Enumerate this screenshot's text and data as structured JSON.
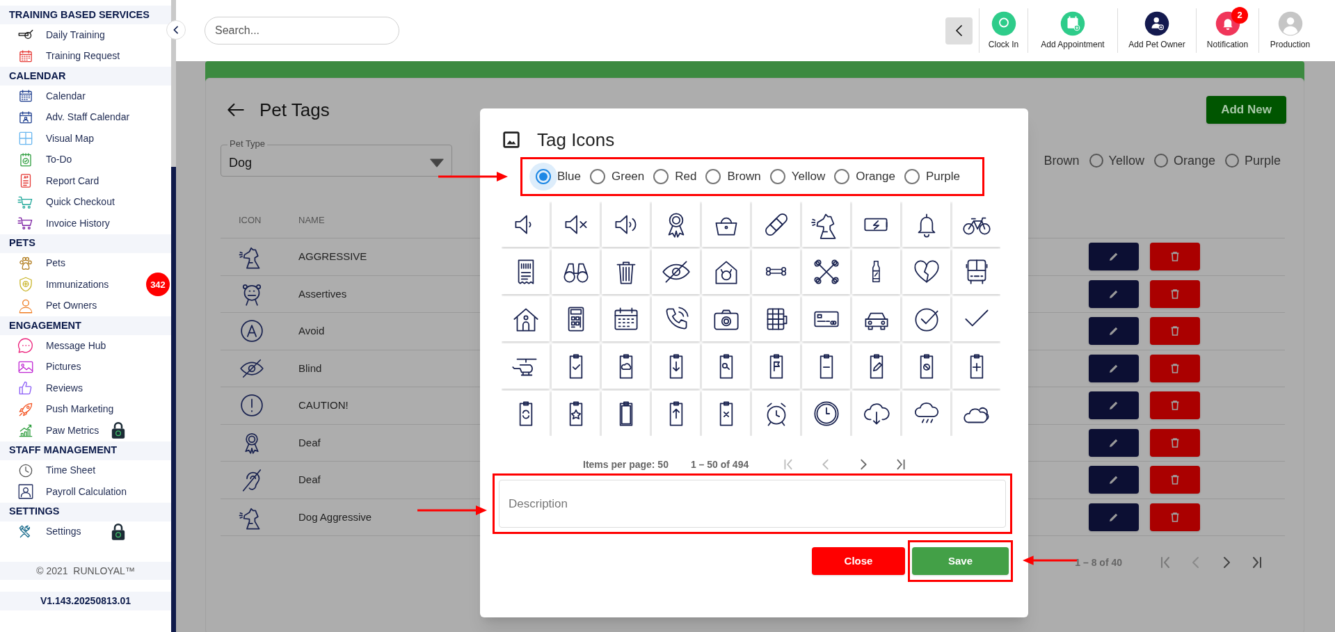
{
  "sidebar": {
    "sections": [
      {
        "title": "TRAINING BASED SERVICES",
        "items": [
          {
            "label": "Daily Training",
            "locked": false
          },
          {
            "label": "Training Request",
            "locked": false
          }
        ]
      },
      {
        "title": "CALENDAR",
        "items": [
          {
            "label": "Calendar",
            "locked": false
          },
          {
            "label": "Adv. Staff Calendar",
            "locked": false
          },
          {
            "label": "Visual Map",
            "locked": false
          },
          {
            "label": "To-Do",
            "locked": false
          },
          {
            "label": "Report Card",
            "locked": false
          },
          {
            "label": "Quick Checkout",
            "locked": false
          },
          {
            "label": "Invoice History",
            "locked": false
          }
        ]
      },
      {
        "title": "PETS",
        "items": [
          {
            "label": "Pets",
            "locked": false
          },
          {
            "label": "Immunizations",
            "locked": false,
            "badge": "342"
          },
          {
            "label": "Pet Owners",
            "locked": false
          }
        ]
      },
      {
        "title": "ENGAGEMENT",
        "items": [
          {
            "label": "Message Hub",
            "locked": false
          },
          {
            "label": "Pictures",
            "locked": false
          },
          {
            "label": "Reviews",
            "locked": false
          },
          {
            "label": "Push Marketing",
            "locked": false
          },
          {
            "label": "Paw Metrics",
            "locked": true
          }
        ]
      },
      {
        "title": "STAFF MANAGEMENT",
        "items": [
          {
            "label": "Time Sheet",
            "locked": false
          },
          {
            "label": "Payroll Calculation",
            "locked": false
          }
        ]
      },
      {
        "title": "SETTINGS",
        "items": [
          {
            "label": "Settings",
            "locked": true
          }
        ]
      }
    ],
    "footer": "© 2021  RUNLOYAL™",
    "version": "V1.143.20250813.01"
  },
  "search": {
    "placeholder": "Search..."
  },
  "toolbar": {
    "actions": [
      {
        "label": "Clock In"
      },
      {
        "label": "Add Appointment"
      },
      {
        "label": "Add Pet Owner"
      },
      {
        "label": "Notification",
        "badge": "2"
      },
      {
        "label": "Production"
      }
    ]
  },
  "page": {
    "title": "Pet Tags",
    "pet_type": {
      "label": "Pet Type",
      "value": "Dog"
    },
    "add_button": "Add New",
    "color_options": [
      {
        "label": "Brown"
      },
      {
        "label": "Yellow",
        "selected": false
      },
      {
        "label": "Orange",
        "selected": false
      },
      {
        "label": "Purple",
        "selected": false
      }
    ],
    "table": {
      "columns": [
        "ICON",
        "NAME"
      ],
      "rows": [
        {
          "name": "AGGRESSIVE"
        },
        {
          "name": "Assertives"
        },
        {
          "name": "Avoid"
        },
        {
          "name": "Blind"
        },
        {
          "name": "CAUTION!"
        },
        {
          "name": "Deaf"
        },
        {
          "name": "Deaf"
        },
        {
          "name": "Dog Aggressive"
        }
      ]
    },
    "pagination": {
      "range": "1 – 8 of 40"
    }
  },
  "dialog": {
    "title": "Tag Icons",
    "colors": [
      {
        "label": "Blue",
        "selected": true
      },
      {
        "label": "Green",
        "selected": false
      },
      {
        "label": "Red",
        "selected": false
      },
      {
        "label": "Brown",
        "selected": false
      },
      {
        "label": "Yellow",
        "selected": false
      },
      {
        "label": "Orange",
        "selected": false
      },
      {
        "label": "Purple",
        "selected": false
      }
    ],
    "pagination": {
      "items_per_page": "Items per page: 50",
      "range": "1 – 50 of 494"
    },
    "description": {
      "placeholder": "Description"
    },
    "buttons": [
      {
        "label": "Close",
        "kind": "close"
      },
      {
        "label": "Save",
        "kind": "save"
      }
    ]
  }
}
